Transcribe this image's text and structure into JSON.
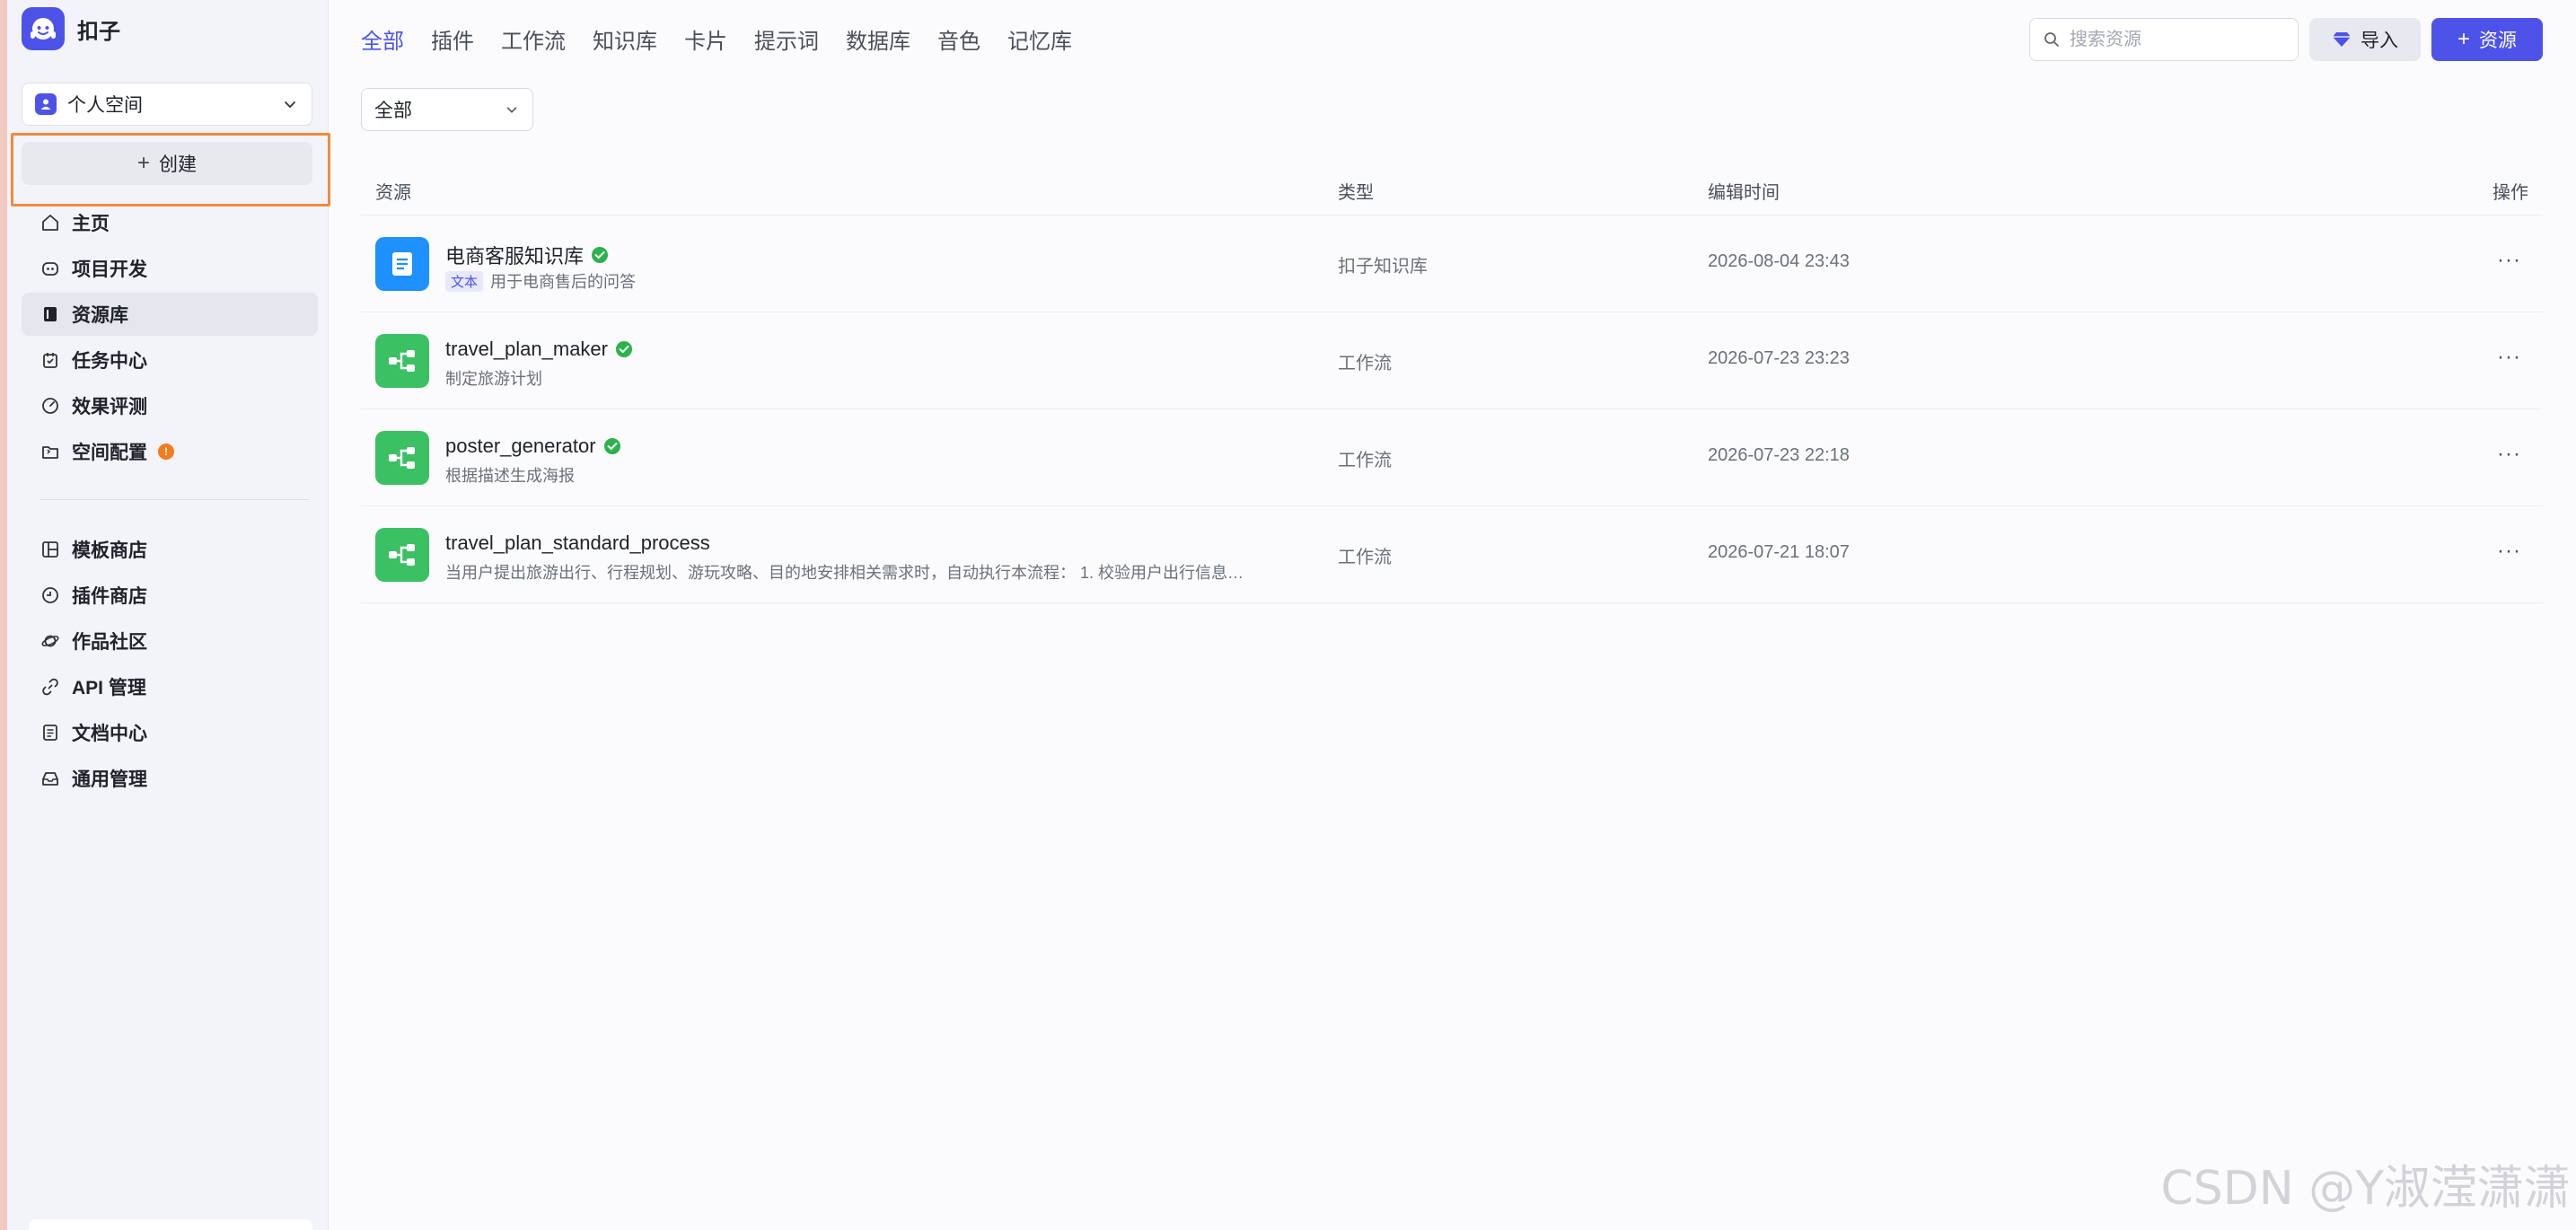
{
  "app": {
    "name": "扣子",
    "brand_color": "#4d53e8"
  },
  "sidebar": {
    "space_selector": {
      "label": "个人空间"
    },
    "create_label": "创建",
    "nav_primary": [
      {
        "label": "主页",
        "icon": "home-icon"
      },
      {
        "label": "项目开发",
        "icon": "robot-icon"
      },
      {
        "label": "资源库",
        "icon": "book-icon",
        "active": true
      },
      {
        "label": "任务中心",
        "icon": "task-icon"
      },
      {
        "label": "效果评测",
        "icon": "gauge-icon"
      },
      {
        "label": "空间配置",
        "icon": "folder-settings-icon",
        "badge": "!"
      }
    ],
    "nav_secondary": [
      {
        "label": "模板商店",
        "icon": "template-icon"
      },
      {
        "label": "插件商店",
        "icon": "plugin-icon"
      },
      {
        "label": "作品社区",
        "icon": "planet-icon"
      },
      {
        "label": "API 管理",
        "icon": "link-icon"
      },
      {
        "label": "文档中心",
        "icon": "document-icon"
      },
      {
        "label": "通用管理",
        "icon": "inbox-icon"
      }
    ]
  },
  "header": {
    "tabs": [
      "全部",
      "插件",
      "工作流",
      "知识库",
      "卡片",
      "提示词",
      "数据库",
      "音色",
      "记忆库"
    ],
    "active_tab": "全部",
    "search": {
      "placeholder": "搜索资源",
      "value": ""
    },
    "import_label": "导入",
    "resource_label": "资源"
  },
  "filter": {
    "selected": "全部"
  },
  "table": {
    "columns": {
      "resource": "资源",
      "type": "类型",
      "time": "编辑时间",
      "ops": "操作"
    },
    "rows": [
      {
        "title": "电商客服知识库",
        "verified": true,
        "tag": "文本",
        "desc": "用于电商售后的问答",
        "type": "扣子知识库",
        "time": "2026-08-04 23:43",
        "icon": "document-icon",
        "icon_color": "#1e90ff",
        "more": "···"
      },
      {
        "title": "travel_plan_maker",
        "verified": true,
        "tag": "",
        "desc": "制定旅游计划",
        "type": "工作流",
        "time": "2026-07-23 23:23",
        "icon": "workflow-icon",
        "icon_color": "#3cc064",
        "more": "···"
      },
      {
        "title": "poster_generator",
        "verified": true,
        "tag": "",
        "desc": "根据描述生成海报",
        "type": "工作流",
        "time": "2026-07-23 22:18",
        "icon": "workflow-icon",
        "icon_color": "#3cc064",
        "more": "···"
      },
      {
        "title": "travel_plan_standard_process",
        "verified": false,
        "tag": "",
        "desc": "当用户提出旅游出行、行程规划、游玩攻略、目的地安排相关需求时，自动执行本流程： 1. 校验用户出行信息…",
        "type": "工作流",
        "time": "2026-07-21 18:07",
        "icon": "workflow-icon",
        "icon_color": "#3cc064",
        "more": "···"
      }
    ]
  },
  "watermark": "CSDN @Y淑滢潇潇"
}
